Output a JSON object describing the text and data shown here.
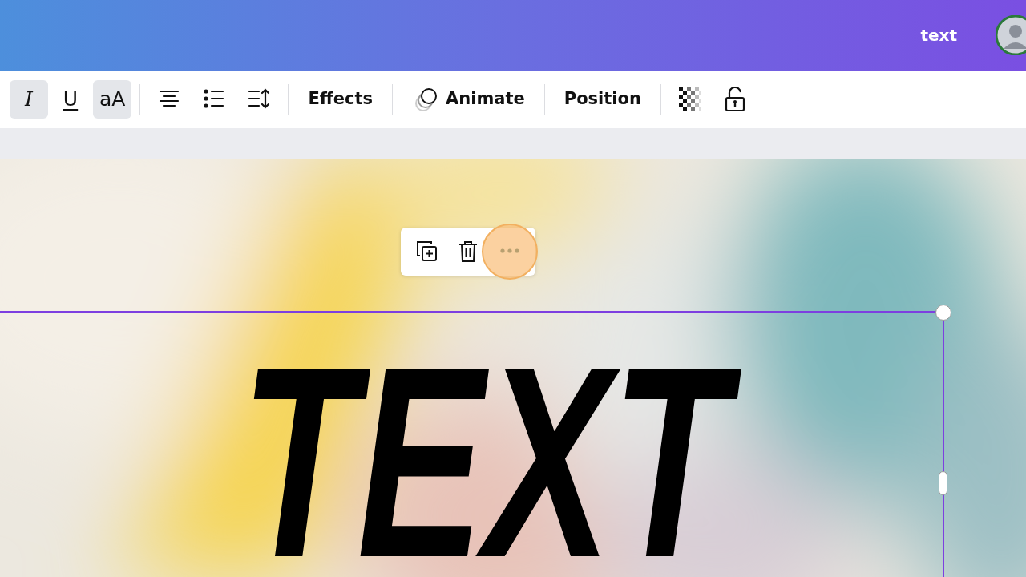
{
  "header": {
    "title": "text"
  },
  "toolbar": [
    {
      "kind": "italic",
      "label": "I",
      "selected": true
    },
    {
      "kind": "underline",
      "label": "U",
      "selected": false
    },
    {
      "kind": "case",
      "label": "aA",
      "selected": true
    },
    {
      "kind": "divider"
    },
    {
      "kind": "align"
    },
    {
      "kind": "list"
    },
    {
      "kind": "spacing"
    },
    {
      "kind": "divider"
    },
    {
      "kind": "text",
      "label": "Effects"
    },
    {
      "kind": "divider"
    },
    {
      "kind": "animate",
      "label": "Animate"
    },
    {
      "kind": "divider"
    },
    {
      "kind": "text",
      "label": "Position"
    },
    {
      "kind": "divider"
    },
    {
      "kind": "transparency"
    },
    {
      "kind": "lock"
    }
  ],
  "element_menu": [
    {
      "kind": "duplicate",
      "highlighted": false
    },
    {
      "kind": "delete",
      "highlighted": false
    },
    {
      "kind": "more",
      "highlighted": true
    }
  ],
  "canvas": {
    "text": "TEXT",
    "selected": true
  }
}
